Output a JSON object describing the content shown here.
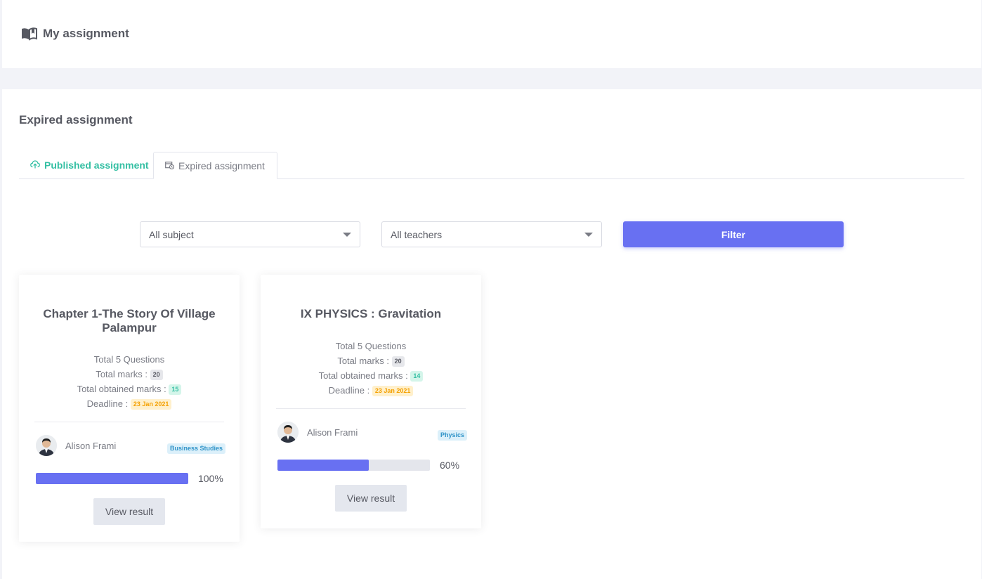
{
  "header": {
    "title": "My assignment",
    "icon": "book-open-icon"
  },
  "section": {
    "title": "Expired assignment"
  },
  "tabs": [
    {
      "label": "Published assignment",
      "icon": "cloud-upload-icon",
      "color": "#34bfa3"
    },
    {
      "label": "Expired assignment",
      "icon": "calendar-clock-icon",
      "active": true
    }
  ],
  "filters": {
    "subject": {
      "selected": "All subject"
    },
    "teacher": {
      "selected": "All teachers"
    },
    "button_label": "Filter"
  },
  "colors": {
    "accent": "#6870f2",
    "success": "#34bfa3",
    "warning": "#f4a000",
    "info": "#2f93c8"
  },
  "assignments": [
    {
      "title": "Chapter 1-The Story Of Village Palampur",
      "questions": "Total 5 Questions",
      "total_marks_label": "Total marks :",
      "total_marks": "20",
      "obtained_label": "Total obtained marks :",
      "obtained": "15",
      "deadline_label": "Deadline :",
      "deadline": "23 Jan 2021",
      "teacher": "Alison Frami",
      "subject": "Business Studies",
      "progress": 100,
      "progress_label": "100%",
      "button_label": "View result"
    },
    {
      "title": "IX PHYSICS : Gravitation",
      "questions": "Total 5 Questions",
      "total_marks_label": "Total marks :",
      "total_marks": "20",
      "obtained_label": "Total obtained marks :",
      "obtained": "14",
      "deadline_label": "Deadline :",
      "deadline": "23 Jan 2021",
      "teacher": "Alison Frami",
      "subject": "Physics",
      "progress": 60,
      "progress_label": "60%",
      "button_label": "View result"
    }
  ]
}
